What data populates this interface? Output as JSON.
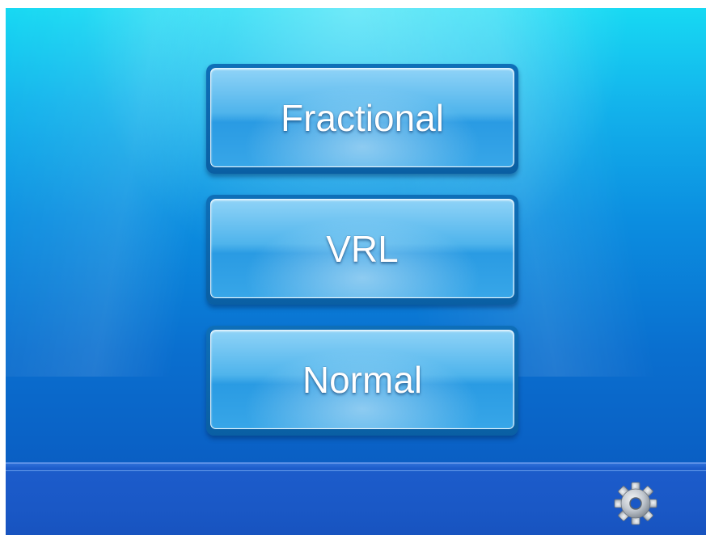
{
  "buttons": {
    "fractional_label": "Fractional",
    "vrl_label": "VRL",
    "normal_label": "Normal"
  },
  "icons": {
    "settings": "gear-icon"
  },
  "colors": {
    "background_top": "#17d9f3",
    "background_bottom": "#0a58bd",
    "button_face": "#4fb4ec",
    "footer": "#1a58c6",
    "gear": "#c8cdd3"
  }
}
